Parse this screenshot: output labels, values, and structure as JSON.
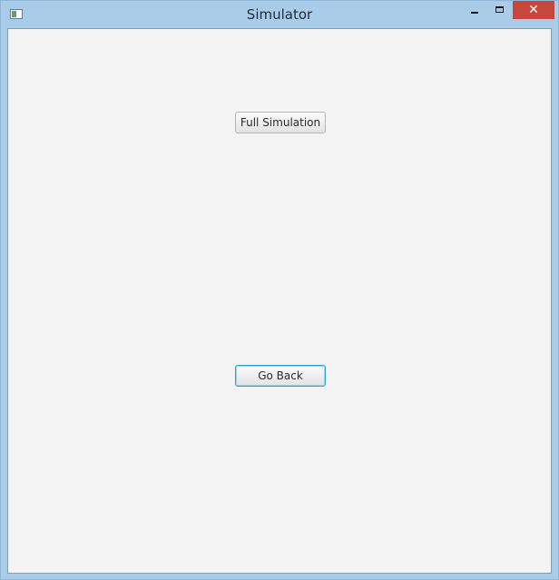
{
  "window": {
    "title": "Simulator",
    "icons": {
      "app": "app-window-icon",
      "minimize": "minimize-icon",
      "maximize": "maximize-icon",
      "close": "close-icon"
    },
    "close_glyph": "✕",
    "colors": {
      "frame": "#a9cde9",
      "client_background": "#f4f4f4",
      "close_button": "#c7473d",
      "focus_border": "#2a9fd6"
    }
  },
  "main": {
    "full_simulation_label": "Full Simulation",
    "go_back_label": "Go Back"
  }
}
